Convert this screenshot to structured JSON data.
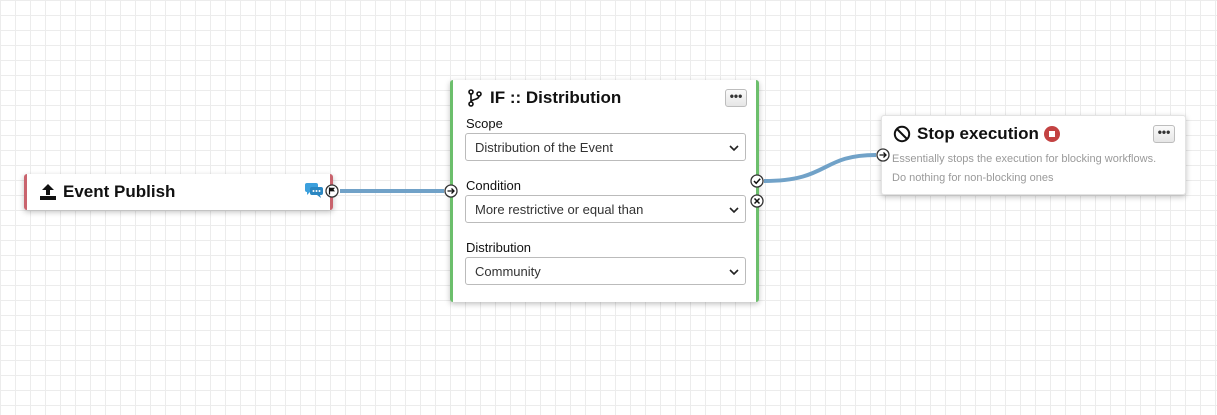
{
  "colors": {
    "wire": "#71a2c8",
    "trigger_border": "#c9636d",
    "if_border": "#6cbf6c",
    "stop_badge": "#c34242",
    "chat_icon": "#3ca0dd"
  },
  "trigger_node": {
    "title": "Event Publish",
    "icon": "upload-icon",
    "badge_icon": "comments-icon",
    "output_port_icon": "flag-icon"
  },
  "if_node": {
    "title": "IF :: Distribution",
    "icon": "code-branch-icon",
    "options_label": "•••",
    "fields": [
      {
        "label": "Scope",
        "value": "Distribution of the Event"
      },
      {
        "label": "Condition",
        "value": "More restrictive or equal than"
      },
      {
        "label": "Distribution",
        "value": "Community"
      }
    ]
  },
  "stop_node": {
    "title": "Stop execution",
    "icon": "ban-icon",
    "badge_icon": "stop-circle-icon",
    "options_label": "•••",
    "description_line1": "Essentially stops the execution for blocking workflows.",
    "description_line2": "Do nothing for non-blocking ones"
  }
}
